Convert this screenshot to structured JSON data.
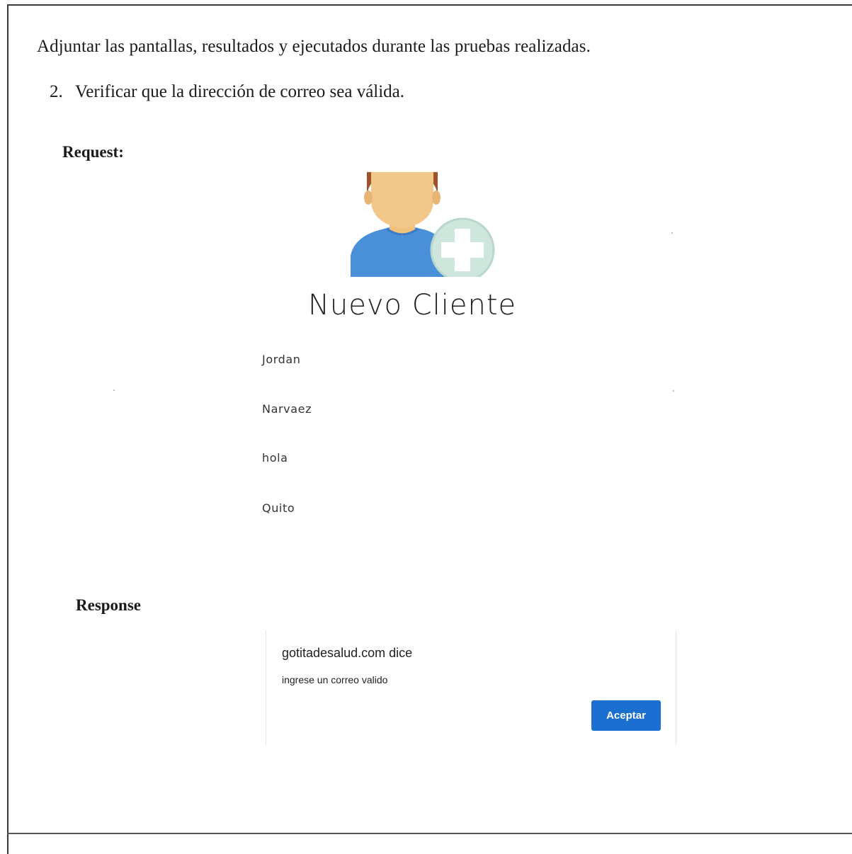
{
  "document": {
    "intro": "Adjuntar las pantallas, resultados y ejecutados  durante las pruebas realizadas.",
    "step_number": "2.",
    "step_text": "Verificar que la dirección de correo sea válida.",
    "request_label": "Request:",
    "response_label": "Response"
  },
  "form": {
    "title": "Nuevo Cliente",
    "avatar_icon": "user-add-icon",
    "fields": [
      {
        "value": "Jordan"
      },
      {
        "value": "Narvaez"
      },
      {
        "value": "hola"
      },
      {
        "value": "Quito"
      }
    ]
  },
  "dialog": {
    "title": "gotitadesalud.com dice",
    "message": "ingrese un correo valido",
    "button_label": "Aceptar",
    "button_color": "#1a6fd0"
  }
}
